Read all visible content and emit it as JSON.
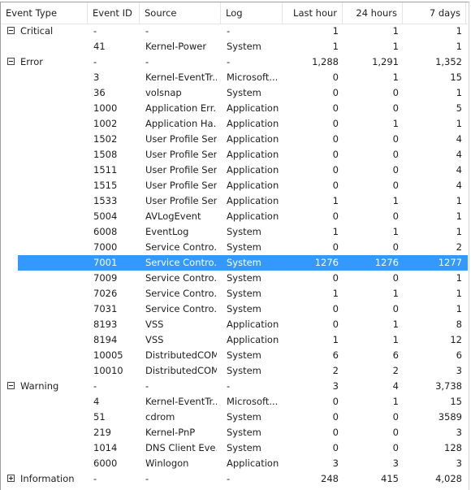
{
  "columns": [
    "Event Type",
    "Event ID",
    "Source",
    "Log",
    "Last hour",
    "24 hours",
    "7 days"
  ],
  "accent": "#3399ff",
  "rows": [
    {
      "type": "Critical",
      "group": true,
      "expanded": true,
      "id": "-",
      "source": "-",
      "log": "-",
      "h": "1",
      "d": "1",
      "w": "1"
    },
    {
      "id": "41",
      "source": "Kernel-Power",
      "log": "System",
      "h": "1",
      "d": "1",
      "w": "1"
    },
    {
      "type": "Error",
      "group": true,
      "expanded": true,
      "id": "-",
      "source": "-",
      "log": "-",
      "h": "1,288",
      "d": "1,291",
      "w": "1,352"
    },
    {
      "id": "3",
      "source": "Kernel-EventTr...",
      "log": "Microsoft...",
      "h": "0",
      "d": "1",
      "w": "15"
    },
    {
      "id": "36",
      "source": "volsnap",
      "log": "System",
      "h": "0",
      "d": "0",
      "w": "1"
    },
    {
      "id": "1000",
      "source": "Application Err...",
      "log": "Application",
      "h": "0",
      "d": "0",
      "w": "5"
    },
    {
      "id": "1002",
      "source": "Application Ha...",
      "log": "Application",
      "h": "0",
      "d": "1",
      "w": "1"
    },
    {
      "id": "1502",
      "source": "User Profile Ser...",
      "log": "Application",
      "h": "0",
      "d": "0",
      "w": "4"
    },
    {
      "id": "1508",
      "source": "User Profile Ser...",
      "log": "Application",
      "h": "0",
      "d": "0",
      "w": "4"
    },
    {
      "id": "1511",
      "source": "User Profile Ser...",
      "log": "Application",
      "h": "0",
      "d": "0",
      "w": "4"
    },
    {
      "id": "1515",
      "source": "User Profile Ser...",
      "log": "Application",
      "h": "0",
      "d": "0",
      "w": "4"
    },
    {
      "id": "1533",
      "source": "User Profile Ser...",
      "log": "Application",
      "h": "1",
      "d": "1",
      "w": "1"
    },
    {
      "id": "5004",
      "source": "AVLogEvent",
      "log": "Application",
      "h": "0",
      "d": "0",
      "w": "1"
    },
    {
      "id": "6008",
      "source": "EventLog",
      "log": "System",
      "h": "1",
      "d": "1",
      "w": "1"
    },
    {
      "id": "7000",
      "source": "Service Contro...",
      "log": "System",
      "h": "0",
      "d": "0",
      "w": "2"
    },
    {
      "id": "7001",
      "source": "Service Contro...",
      "log": "System",
      "h": "1276",
      "d": "1276",
      "w": "1277",
      "selected": true
    },
    {
      "id": "7009",
      "source": "Service Contro...",
      "log": "System",
      "h": "0",
      "d": "0",
      "w": "1"
    },
    {
      "id": "7026",
      "source": "Service Contro...",
      "log": "System",
      "h": "1",
      "d": "1",
      "w": "1"
    },
    {
      "id": "7031",
      "source": "Service Contro...",
      "log": "System",
      "h": "0",
      "d": "0",
      "w": "1"
    },
    {
      "id": "8193",
      "source": "VSS",
      "log": "Application",
      "h": "0",
      "d": "1",
      "w": "8"
    },
    {
      "id": "8194",
      "source": "VSS",
      "log": "Application",
      "h": "1",
      "d": "1",
      "w": "12"
    },
    {
      "id": "10005",
      "source": "DistributedCOM",
      "log": "System",
      "h": "6",
      "d": "6",
      "w": "6"
    },
    {
      "id": "10010",
      "source": "DistributedCOM",
      "log": "System",
      "h": "2",
      "d": "2",
      "w": "3"
    },
    {
      "type": "Warning",
      "group": true,
      "expanded": true,
      "id": "-",
      "source": "-",
      "log": "-",
      "h": "3",
      "d": "4",
      "w": "3,738"
    },
    {
      "id": "4",
      "source": "Kernel-EventTr...",
      "log": "Microsoft...",
      "h": "0",
      "d": "1",
      "w": "15"
    },
    {
      "id": "51",
      "source": "cdrom",
      "log": "System",
      "h": "0",
      "d": "0",
      "w": "3589"
    },
    {
      "id": "219",
      "source": "Kernel-PnP",
      "log": "System",
      "h": "0",
      "d": "0",
      "w": "3"
    },
    {
      "id": "1014",
      "source": "DNS Client Eve...",
      "log": "System",
      "h": "0",
      "d": "0",
      "w": "128"
    },
    {
      "id": "6000",
      "source": "Winlogon",
      "log": "Application",
      "h": "3",
      "d": "3",
      "w": "3"
    },
    {
      "type": "Information",
      "group": true,
      "expanded": false,
      "id": "-",
      "source": "-",
      "log": "-",
      "h": "248",
      "d": "415",
      "w": "4,028"
    }
  ]
}
